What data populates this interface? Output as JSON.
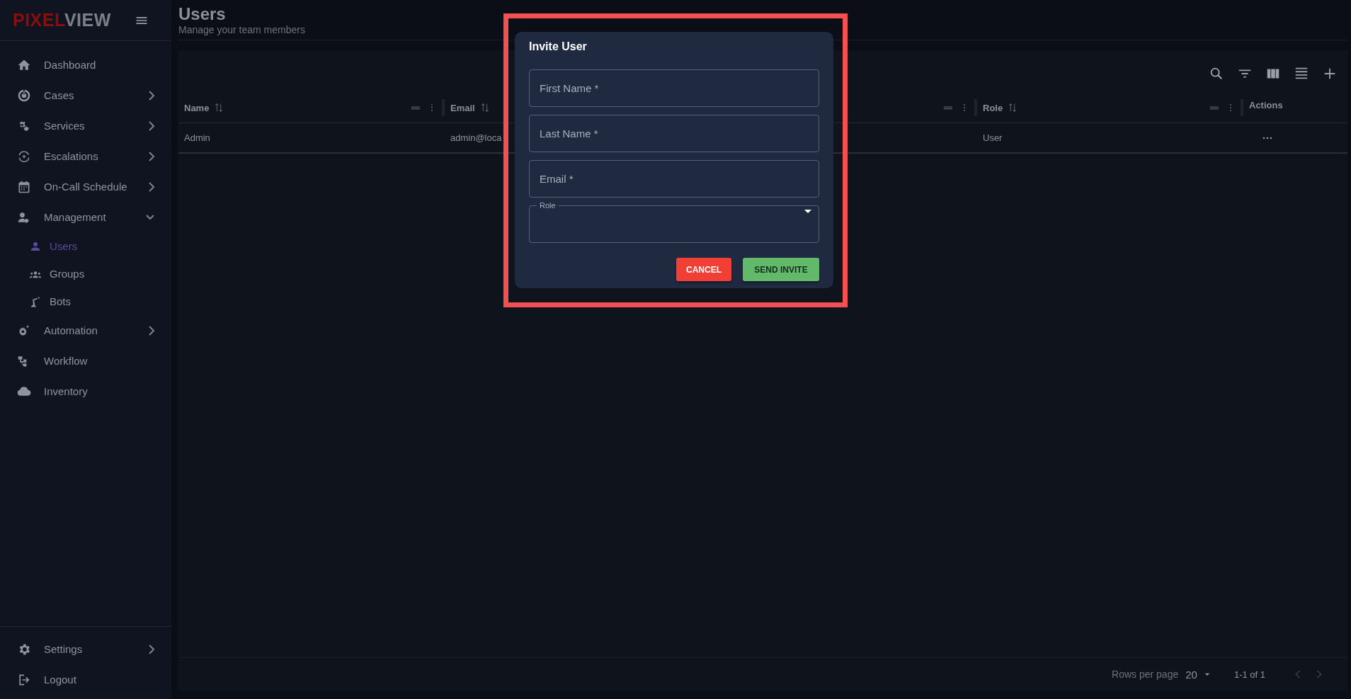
{
  "sidebar": {
    "logo": {
      "accent": "PIXEL",
      "rest": "VIEW"
    },
    "items": [
      {
        "label": "Dashboard"
      },
      {
        "label": "Cases",
        "expanded": false
      },
      {
        "label": "Services",
        "expanded": false
      },
      {
        "label": "Escalations",
        "expanded": false
      },
      {
        "label": "On-Call Schedule",
        "expanded": false
      },
      {
        "label": "Management",
        "expanded": true,
        "children": [
          {
            "label": "Users",
            "selected": true
          },
          {
            "label": "Groups",
            "selected": false
          },
          {
            "label": "Bots",
            "selected": false
          }
        ]
      },
      {
        "label": "Automation",
        "expanded": false
      },
      {
        "label": "Workflow"
      },
      {
        "label": "Inventory"
      }
    ],
    "footer_items": [
      {
        "label": "Settings",
        "expanded": false
      },
      {
        "label": "Logout"
      }
    ]
  },
  "page": {
    "title": "Users",
    "subtitle": "Manage your team members"
  },
  "table": {
    "columns": [
      {
        "label": "Name",
        "kind": "data",
        "menu": true
      },
      {
        "label": "Email",
        "kind": "data"
      },
      {
        "kind": "data",
        "menu": true
      },
      {
        "label": "Role",
        "kind": "data",
        "menu": true
      },
      {
        "label": "Actions",
        "kind": "actions"
      }
    ],
    "rows": [
      {
        "cells": [
          "Admin",
          "admin@loca",
          null,
          "User"
        ]
      }
    ],
    "pagination": {
      "rows_per_page_label": "Rows per page",
      "rows_per_page": "20",
      "range": "1-1 of 1",
      "prev_disabled": true,
      "next_disabled": true
    }
  },
  "dialog": {
    "title": "Invite User",
    "fields": [
      {
        "placeholder": "First Name *",
        "kind": "text"
      },
      {
        "placeholder": "Last Name *",
        "kind": "text"
      },
      {
        "placeholder": "Email *",
        "kind": "text"
      },
      {
        "label": "Role",
        "kind": "select"
      }
    ],
    "buttons": [
      {
        "label": "CANCEL",
        "kind": "cancel"
      },
      {
        "label": "SEND INVITE",
        "kind": "confirm"
      }
    ]
  }
}
